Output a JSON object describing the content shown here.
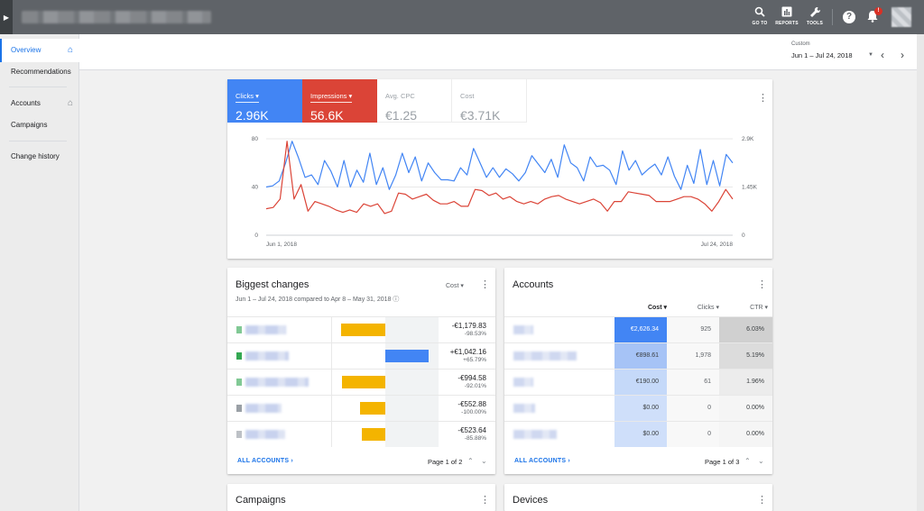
{
  "topbar": {
    "tools": [
      {
        "icon": "search-icon",
        "label": "GO TO"
      },
      {
        "icon": "bar-chart-icon",
        "label": "REPORTS"
      },
      {
        "icon": "wrench-icon",
        "label": "TOOLS"
      }
    ],
    "help_glyph": "?",
    "notification_badge": "!"
  },
  "sidebar": {
    "items": [
      {
        "label": "Overview"
      },
      {
        "label": "Recommendations"
      },
      {
        "label": "Accounts"
      },
      {
        "label": "Campaigns"
      },
      {
        "label": "Change history"
      }
    ]
  },
  "date_range": {
    "label": "Custom",
    "value": "Jun 1 – Jul 24, 2018"
  },
  "metrics": [
    {
      "label": "Clicks",
      "value": "2.96K",
      "style": "blue",
      "dropdown": true
    },
    {
      "label": "Impressions",
      "value": "56.6K",
      "style": "red",
      "dropdown": true
    },
    {
      "label": "Avg. CPC",
      "value": "€1.25",
      "style": "plain",
      "dropdown": false
    },
    {
      "label": "Cost",
      "value": "€3.71K",
      "style": "plain",
      "dropdown": false
    }
  ],
  "chart_data": {
    "type": "line",
    "x_start_label": "Jun 1, 2018",
    "x_end_label": "Jul 24, 2018",
    "y_left": {
      "ticks": [
        "0",
        "40",
        "80"
      ],
      "ylim": [
        0,
        80
      ]
    },
    "y_right": {
      "ticks": [
        "0",
        "1.45K",
        "2.9K"
      ],
      "ylim": [
        0,
        2900
      ]
    },
    "grid": true,
    "series": [
      {
        "name": "Clicks",
        "color": "#4285f4",
        "axis": "left",
        "values": [
          40,
          41,
          45,
          60,
          78,
          64,
          48,
          50,
          42,
          62,
          53,
          40,
          62,
          40,
          54,
          44,
          68,
          42,
          56,
          38,
          50,
          68,
          52,
          65,
          45,
          60,
          52,
          46,
          46,
          45,
          56,
          50,
          72,
          60,
          48,
          56,
          48,
          55,
          51,
          45,
          52,
          66,
          59,
          52,
          63,
          48,
          75,
          60,
          56,
          45,
          65,
          57,
          58,
          54,
          42,
          70,
          54,
          62,
          50,
          55,
          59,
          50,
          65,
          49,
          38,
          58,
          43,
          71,
          42,
          62,
          41,
          67,
          60
        ]
      },
      {
        "name": "Impressions",
        "color": "#db4437",
        "axis": "left",
        "values": [
          22,
          23,
          30,
          78,
          30,
          42,
          20,
          28,
          26,
          24,
          21,
          19,
          21,
          19,
          26,
          24,
          26,
          18,
          20,
          35,
          34,
          30,
          32,
          34,
          29,
          26,
          26,
          28,
          24,
          24,
          38,
          37,
          33,
          35,
          30,
          32,
          28,
          26,
          28,
          26,
          30,
          32,
          33,
          30,
          28,
          26,
          28,
          30,
          27,
          20,
          28,
          28,
          36,
          35,
          34,
          33,
          28,
          28,
          28,
          30,
          32,
          32,
          30,
          26,
          20,
          28,
          38,
          30
        ]
      }
    ]
  },
  "biggest_changes": {
    "title": "Biggest changes",
    "selector": "Cost",
    "subtitle": "Jun 1 – Jul 24, 2018 compared to Apr 8 – May 31, 2018",
    "rows": [
      {
        "value": "-€1,179.83",
        "pct": "-98.53%",
        "change": -0.83,
        "swatch": "#81c995"
      },
      {
        "value": "+€1,042.16",
        "pct": "+65.79%",
        "change": 0.82,
        "swatch": "#34a853"
      },
      {
        "value": "-€994.58",
        "pct": "-92.01%",
        "change": -0.82,
        "swatch": "#81c995"
      },
      {
        "value": "-€552.88",
        "pct": "-100.00%",
        "change": -0.47,
        "swatch": "#9aa0a6"
      },
      {
        "value": "-€523.64",
        "pct": "-85.88%",
        "change": -0.44,
        "swatch": "#bdc1c6"
      }
    ],
    "link": "ALL ACCOUNTS",
    "pager": "Page 1 of 2"
  },
  "accounts": {
    "title": "Accounts",
    "columns": [
      "Cost",
      "Clicks",
      "CTR"
    ],
    "rows": [
      {
        "cost": "€2,626.34",
        "clicks": "925",
        "ctr": "6.03%",
        "cost_bg": "#4285f4",
        "cost_fg": "#ffffff",
        "ctr_bg": "#d0d0d0"
      },
      {
        "cost": "€898.61",
        "clicks": "1,978",
        "ctr": "5.19%",
        "cost_bg": "#a6c3f6",
        "cost_fg": "#3c4043",
        "ctr_bg": "#dcdcdc"
      },
      {
        "cost": "€190.00",
        "clicks": "61",
        "ctr": "1.96%",
        "cost_bg": "#c5d9f9",
        "cost_fg": "#3c4043",
        "ctr_bg": "#ececec"
      },
      {
        "cost": "$0.00",
        "clicks": "0",
        "ctr": "0.00%",
        "cost_bg": "#cfdffa",
        "cost_fg": "#3c4043",
        "ctr_bg": "#f5f5f5"
      },
      {
        "cost": "$0.00",
        "clicks": "0",
        "ctr": "0.00%",
        "cost_bg": "#cfdffa",
        "cost_fg": "#3c4043",
        "ctr_bg": "#f5f5f5"
      }
    ],
    "link": "ALL ACCOUNTS",
    "pager": "Page 1 of 3"
  },
  "bottom_cards": [
    {
      "title": "Campaigns"
    },
    {
      "title": "Devices"
    }
  ]
}
